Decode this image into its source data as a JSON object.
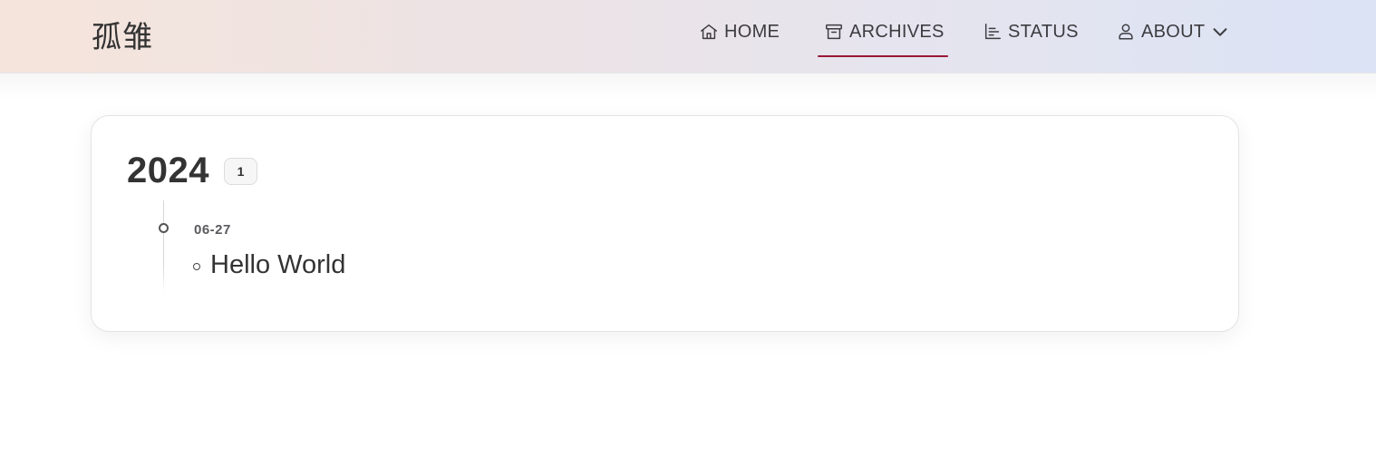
{
  "site": {
    "title": "孤雏"
  },
  "nav": {
    "items": [
      {
        "label": "HOME",
        "icon": "home-icon"
      },
      {
        "label": "ARCHIVES",
        "icon": "archive-icon",
        "active": true
      },
      {
        "label": "STATUS",
        "icon": "bar-chart-icon"
      },
      {
        "label": "ABOUT",
        "icon": "user-icon",
        "dropdown_icon": "chevron-down-icon"
      }
    ],
    "active_color": "#9a1737"
  },
  "archives": {
    "groups": [
      {
        "year": "2024",
        "count": "1",
        "posts": [
          {
            "date": "06-27",
            "title": "Hello World"
          }
        ]
      }
    ]
  }
}
